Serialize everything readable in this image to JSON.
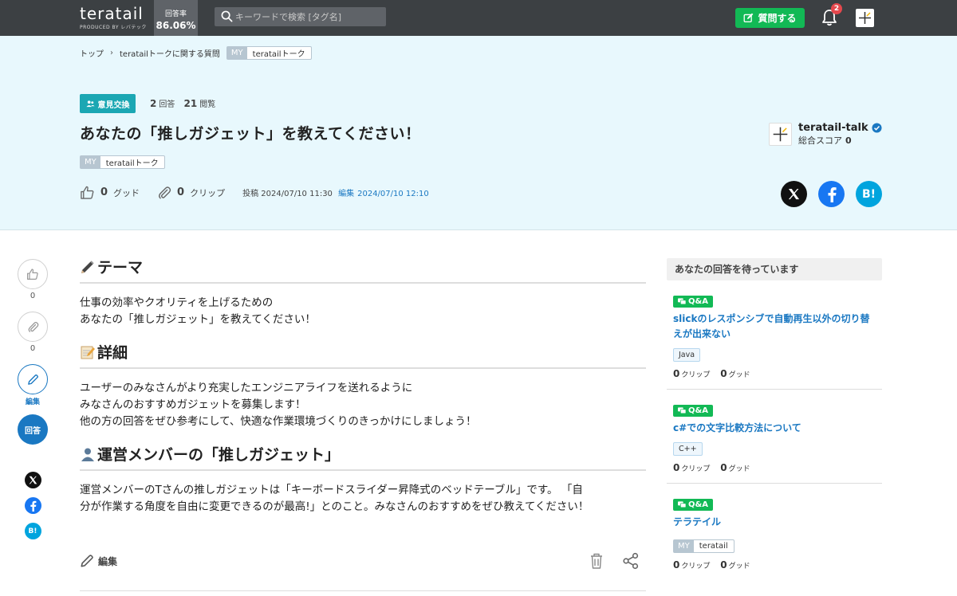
{
  "header": {
    "logo": "teratail",
    "logo_sub": "PRODUCED BY レバテック",
    "rate_label": "回答率",
    "rate_value": "86.06%",
    "search_placeholder": "キーワードで検索 [タグ名]",
    "ask_label": "質問する",
    "notification_count": "2"
  },
  "breadcrumb": {
    "items": [
      "トップ",
      "teratailトークに関する質問"
    ],
    "tag_my": "MY",
    "tag_name": "teratailトーク"
  },
  "question": {
    "category": "意見交換",
    "answers_count": "2",
    "answers_label": "回答",
    "views_count": "21",
    "views_label": "閲覧",
    "title": "あなたの「推しガジェット」を教えてください！",
    "tag_my": "MY",
    "tag_name": "teratailトーク",
    "good_count": "0",
    "good_label": "グッド",
    "clip_count": "0",
    "clip_label": "クリップ",
    "posted_label": "投稿",
    "posted_date": "2024/07/10 11:30",
    "edited_label": "編集",
    "edited_date": "2024/07/10 12:10"
  },
  "author": {
    "name": "teratail-talk",
    "score_label": "総合スコア",
    "score": "0"
  },
  "rail": {
    "good_count": "0",
    "clip_count": "0",
    "edit_label": "編集",
    "answer_label": "回答"
  },
  "body": {
    "theme_heading": "テーマ",
    "theme_lines": [
      "仕事の効率やクオリティを上げるための",
      "あなたの「推しガジェット」を教えてください！"
    ],
    "detail_heading": "詳細",
    "detail_lines": [
      "ユーザーのみなさんがより充実したエンジニアライフを送れるように",
      "みなさんのおすすめガジェットを募集します！",
      "他の方の回答をぜひ参考にして、快適な作業環境づくりのきっかけにしましょう！"
    ],
    "member_heading": "運営メンバーの「推しガジェット」",
    "member_lines": [
      "運営メンバーのTさんの推しガジェットは「キーボードスライダー昇降式のベッドテーブル」です。 「自",
      "分が作業する角度を自由に変更できるのが最高!」とのこと。みなさんのおすすめをぜひ教えてください！"
    ],
    "edit_label": "編集"
  },
  "sidebar": {
    "heading": "あなたの回答を待っています",
    "items": [
      {
        "badge": "Q&A",
        "title": "slickのレスポンシブで自動再生以外の切り替えが出来ない",
        "tag": "Java",
        "clips": "0",
        "clip_label": "クリップ",
        "goods": "0",
        "good_label": "グッド"
      },
      {
        "badge": "Q&A",
        "title": "c#での文字比較方法について",
        "tag": "C++",
        "clips": "0",
        "clip_label": "クリップ",
        "goods": "0",
        "good_label": "グッド"
      },
      {
        "badge": "Q&A",
        "title": "テラテイル",
        "tag_my": "MY",
        "tag": "teratail",
        "clips": "0",
        "clip_label": "クリップ",
        "goods": "0",
        "good_label": "グッド"
      }
    ]
  },
  "colors": {
    "header_bg": "#3c4043",
    "hero_bg": "#e8f8fd",
    "accent_green": "#12b955",
    "accent_blue": "#1a78c2",
    "category_teal": "#1ba7b3",
    "x_brand": "#111111",
    "facebook_brand": "#1877f2",
    "hatena_brand": "#00a4de"
  }
}
